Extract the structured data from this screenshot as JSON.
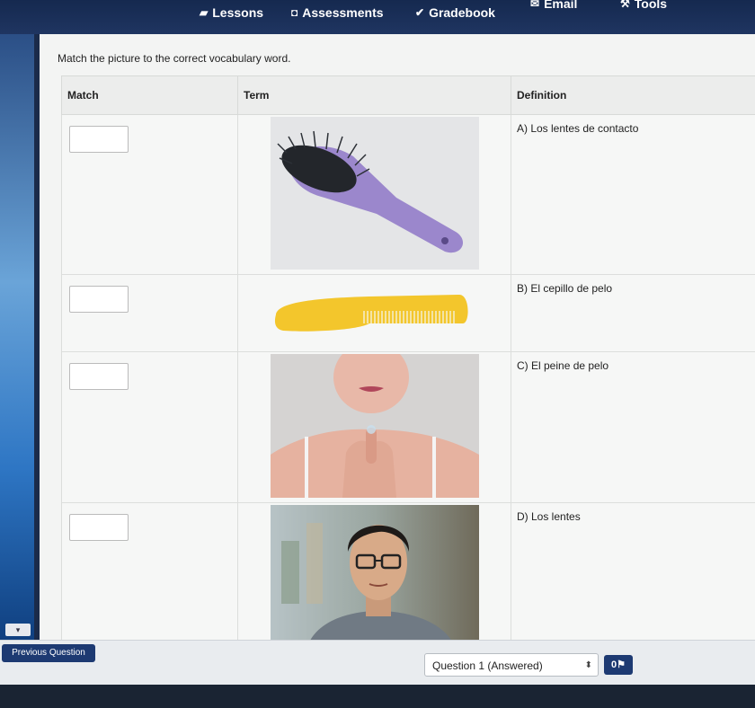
{
  "nav": {
    "lessons": "Lessons",
    "assessments": "Assessments",
    "gradebook": "Gradebook",
    "email": "Email",
    "tools": "Tools"
  },
  "instructions": "Match the picture to the correct vocabulary word.",
  "table": {
    "headers": {
      "match": "Match",
      "term": "Term",
      "definition": "Definition"
    },
    "rows": [
      {
        "match_value": "",
        "term_image": "hair-brush",
        "definition": "A) Los lentes de contacto"
      },
      {
        "match_value": "",
        "term_image": "comb",
        "definition": "B) El cepillo de pelo"
      },
      {
        "match_value": "",
        "term_image": "contact-lens-photo",
        "definition": "C) El peine de pelo"
      },
      {
        "match_value": "",
        "term_image": "man-with-glasses-photo",
        "definition": "D) Los lentes"
      }
    ]
  },
  "footer": {
    "previous_question": "Previous Question",
    "question_selector": "Question 1 (Answered)",
    "flag_label": "0"
  },
  "colors": {
    "nav_bg": "#1b2f58",
    "button_bg": "#1d3a72",
    "brush_handle": "#9b87cc",
    "comb": "#f3c62c"
  }
}
